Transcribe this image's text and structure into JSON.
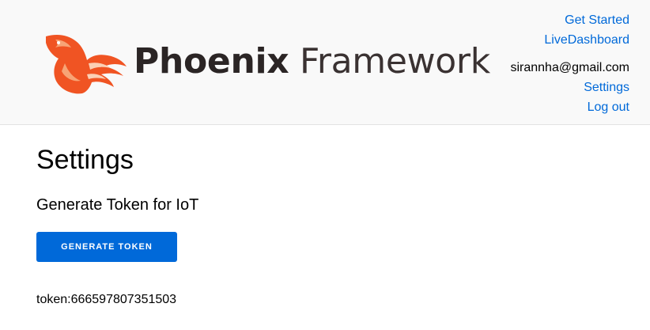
{
  "header": {
    "logo": {
      "text_bold": "Phoenix",
      "text_light": "Framework",
      "icon": "phoenix-bird-icon"
    },
    "nav": {
      "get_started": "Get Started",
      "live_dashboard": "LiveDashboard",
      "user_email": "sirannha@gmail.com",
      "settings": "Settings",
      "log_out": "Log out"
    }
  },
  "main": {
    "title": "Settings",
    "section_title": "Generate Token for IoT",
    "generate_button": "GENERATE TOKEN",
    "token_text": "token:666597807351503"
  },
  "colors": {
    "link": "#0069d9",
    "button_bg": "#0069d9",
    "header_bg": "#f9f9f9",
    "logo_orange": "#f05423",
    "logo_text": "#2b2525"
  }
}
